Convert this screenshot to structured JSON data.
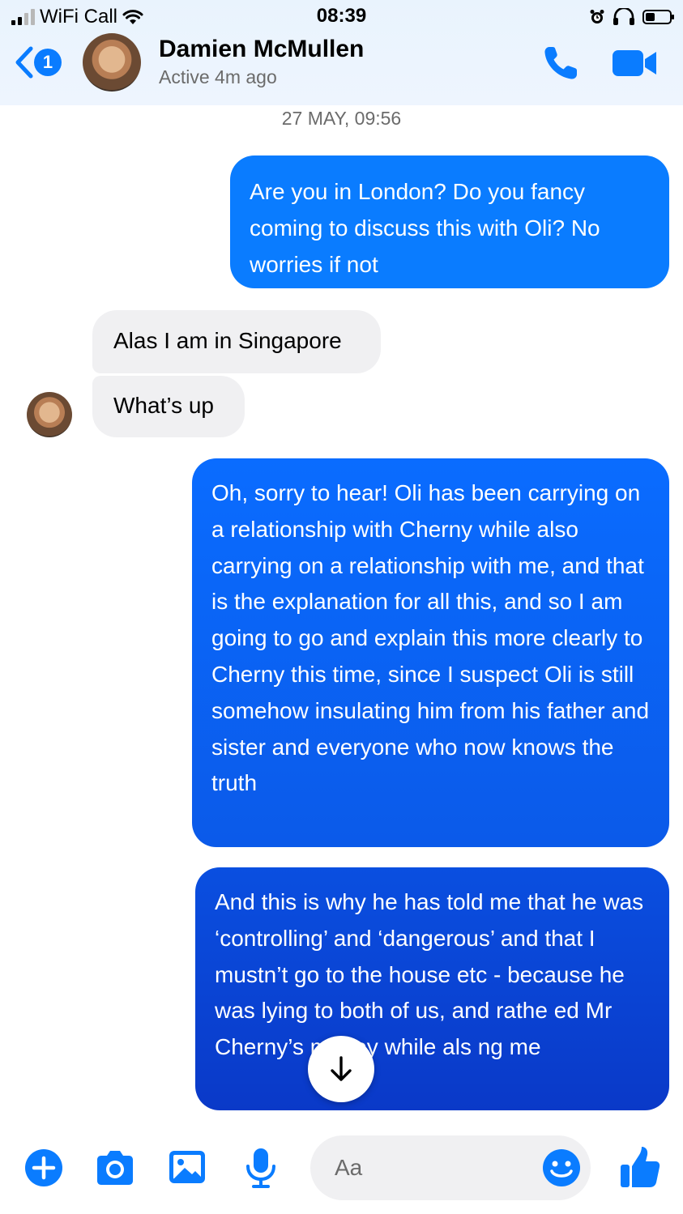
{
  "status_bar": {
    "carrier": "WiFi Call",
    "time": "08:39",
    "signal_bars_filled": 2,
    "signal_bars_total": 4,
    "battery_level": 0.3
  },
  "header": {
    "back_badge": "1",
    "contact_name": "Damien McMullen",
    "active_status": "Active 4m ago"
  },
  "conversation": {
    "timestamp": "27 MAY, 09:56",
    "messages": [
      {
        "direction": "outgoing",
        "text": "Are you in London? Do you fancy coming to discuss this with Oli? No worries if not"
      },
      {
        "direction": "incoming",
        "text": "Alas I am in Singapore"
      },
      {
        "direction": "incoming",
        "text": "What’s up"
      },
      {
        "direction": "outgoing",
        "text": "Oh, sorry to hear! Oli has been carrying on a relationship with Cherny while also carrying on a relationship with me, and that is the explanation for all this, and so I am going to go and explain this more clearly to Cherny this time, since I suspect Oli is still somehow insulating him from his father and sister and everyone who now knows the truth"
      },
      {
        "direction": "outgoing",
        "text": "And this is why he has told me that he was ‘controlling’ and ‘dangerous’ and that I mustn’t go to the house etc - because he was lying to both of us, and rathe ed Mr Cherny’s money while als ng me"
      }
    ]
  },
  "composer": {
    "placeholder": "Aa"
  },
  "icons": {
    "back": "chevron-left-icon",
    "call": "phone-icon",
    "video": "video-camera-icon",
    "scroll_down": "arrow-down-icon",
    "plus": "plus-icon",
    "camera": "camera-icon",
    "gallery": "image-icon",
    "mic": "microphone-icon",
    "emoji": "emoji-icon",
    "like": "thumbs-up-icon"
  },
  "colors": {
    "accent": "#0a7cff",
    "outgoing_bubble_top": "#0a7cff",
    "outgoing_bubble_bottom": "#0a39c8",
    "incoming_bubble": "#f0f0f2",
    "header_band": "#eaf3fd"
  }
}
